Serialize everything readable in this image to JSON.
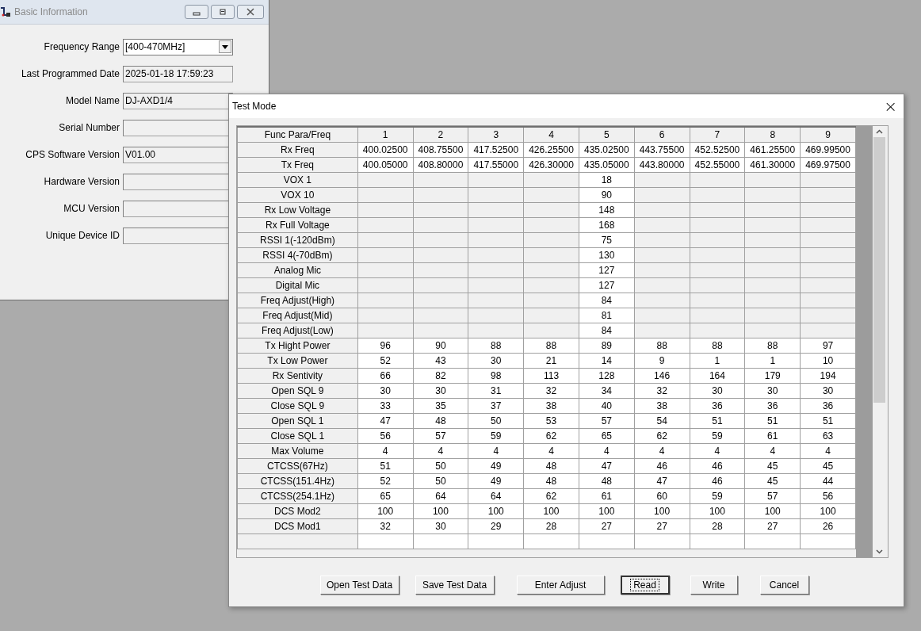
{
  "basic_window": {
    "title": "Basic Information",
    "fields": [
      {
        "label": "Frequency Range",
        "kind": "dropdown",
        "value": "[400-470MHz]"
      },
      {
        "label": "Last Programmed Date",
        "kind": "readonly",
        "value": "2025-01-18 17:59:23"
      },
      {
        "label": "Model Name",
        "kind": "readonly",
        "value": "DJ-AXD1/4"
      },
      {
        "label": "Serial Number",
        "kind": "readonly"
      },
      {
        "label": "CPS Software Version",
        "kind": "readonly",
        "value": "V01.00"
      },
      {
        "label": "Hardware Version",
        "kind": "readonly"
      },
      {
        "label": "MCU Version",
        "kind": "readonly"
      },
      {
        "label": "Unique Device ID",
        "kind": "readonly"
      }
    ]
  },
  "test_dialog": {
    "title": "Test Mode",
    "close": "×",
    "table": {
      "columns": [
        "Func Para/Freq",
        "1",
        "2",
        "3",
        "4",
        "5",
        "6",
        "7",
        "8",
        "9"
      ],
      "rows": [
        [
          "Rx Freq",
          "400.02500",
          "408.75500",
          "417.52500",
          "426.25500",
          "435.02500",
          "443.75500",
          "452.52500",
          "461.25500",
          "469.99500"
        ],
        [
          "Tx Freq",
          "400.05000",
          "408.80000",
          "417.55000",
          "426.30000",
          "435.05000",
          "443.80000",
          "452.55000",
          "461.30000",
          "469.97500"
        ],
        [
          "VOX 1",
          "",
          "",
          "",
          "",
          "18",
          "",
          "",
          "",
          ""
        ],
        [
          "VOX 10",
          "",
          "",
          "",
          "",
          "90",
          "",
          "",
          "",
          ""
        ],
        [
          "Rx Low Voltage",
          "",
          "",
          "",
          "",
          "148",
          "",
          "",
          "",
          ""
        ],
        [
          "Rx Full Voltage",
          "",
          "",
          "",
          "",
          "168",
          "",
          "",
          "",
          ""
        ],
        [
          "RSSI 1(-120dBm)",
          "",
          "",
          "",
          "",
          "75",
          "",
          "",
          "",
          ""
        ],
        [
          "RSSI 4(-70dBm)",
          "",
          "",
          "",
          "",
          "130",
          "",
          "",
          "",
          ""
        ],
        [
          "Analog Mic",
          "",
          "",
          "",
          "",
          "127",
          "",
          "",
          "",
          ""
        ],
        [
          "Digital Mic",
          "",
          "",
          "",
          "",
          "127",
          "",
          "",
          "",
          ""
        ],
        [
          "Freq Adjust(High)",
          "",
          "",
          "",
          "",
          "84",
          "",
          "",
          "",
          ""
        ],
        [
          "Freq Adjust(Mid)",
          "",
          "",
          "",
          "",
          "81",
          "",
          "",
          "",
          ""
        ],
        [
          "Freq Adjust(Low)",
          "",
          "",
          "",
          "",
          "84",
          "",
          "",
          "",
          ""
        ],
        [
          "Tx Hight Power",
          "96",
          "90",
          "88",
          "88",
          "89",
          "88",
          "88",
          "88",
          "97"
        ],
        [
          "Tx Low Power",
          "52",
          "43",
          "30",
          "21",
          "14",
          "9",
          "1",
          "1",
          "10"
        ],
        [
          "Rx Sentivity",
          "66",
          "82",
          "98",
          "113",
          "128",
          "146",
          "164",
          "179",
          "194"
        ],
        [
          "Open SQL 9",
          "30",
          "30",
          "31",
          "32",
          "34",
          "32",
          "30",
          "30",
          "30"
        ],
        [
          "Close SQL 9",
          "33",
          "35",
          "37",
          "38",
          "40",
          "38",
          "36",
          "36",
          "36"
        ],
        [
          "Open SQL 1",
          "47",
          "48",
          "50",
          "53",
          "57",
          "54",
          "51",
          "51",
          "51"
        ],
        [
          "Close SQL 1",
          "56",
          "57",
          "59",
          "62",
          "65",
          "62",
          "59",
          "61",
          "63"
        ],
        [
          "Max Volume",
          "4",
          "4",
          "4",
          "4",
          "4",
          "4",
          "4",
          "4",
          "4"
        ],
        [
          "CTCSS(67Hz)",
          "51",
          "50",
          "49",
          "48",
          "47",
          "46",
          "46",
          "45",
          "45"
        ],
        [
          "CTCSS(151.4Hz)",
          "52",
          "50",
          "49",
          "48",
          "48",
          "47",
          "46",
          "45",
          "44"
        ],
        [
          "CTCSS(254.1Hz)",
          "65",
          "64",
          "64",
          "62",
          "61",
          "60",
          "59",
          "57",
          "56"
        ],
        [
          "DCS Mod2",
          "100",
          "100",
          "100",
          "100",
          "100",
          "100",
          "100",
          "100",
          "100"
        ],
        [
          "DCS Mod1",
          "32",
          "30",
          "29",
          "28",
          "27",
          "27",
          "28",
          "27",
          "26"
        ]
      ]
    },
    "buttons": [
      {
        "label": "Open Test Data",
        "focused": false
      },
      {
        "label": "Save Test Data",
        "focused": false
      },
      {
        "label": "Enter Adjust",
        "focused": false
      },
      {
        "label": "Read",
        "focused": true
      },
      {
        "label": "Write",
        "focused": false
      },
      {
        "label": "Cancel",
        "focused": false
      }
    ]
  }
}
